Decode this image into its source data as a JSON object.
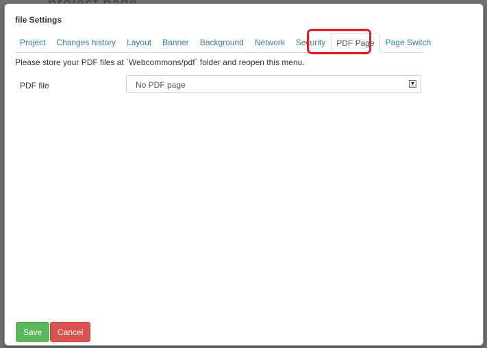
{
  "backdrop": {
    "partial_text": "project page"
  },
  "dialog": {
    "title": "file Settings"
  },
  "tabs": [
    {
      "label": "Project",
      "active": false
    },
    {
      "label": "Changes history",
      "active": false
    },
    {
      "label": "Layout",
      "active": false
    },
    {
      "label": "Banner",
      "active": false
    },
    {
      "label": "Background",
      "active": false
    },
    {
      "label": "Network",
      "active": false
    },
    {
      "label": "Security",
      "active": false
    },
    {
      "label": "PDF Page",
      "active": true
    },
    {
      "label": "Page Switch",
      "active": false
    }
  ],
  "pdf_page": {
    "notice": "Please store your PDF files at `Webcommons/pdf` folder and reopen this menu.",
    "field_label": "PDF file",
    "select_value": "No PDF page"
  },
  "footer": {
    "save_label": "Save",
    "cancel_label": "Cancel"
  },
  "colors": {
    "link": "#337ab7",
    "save": "#5cb85c",
    "cancel": "#d9534f",
    "highlight": "#e02020"
  },
  "icons": {
    "select_arrow": "chevron-down-icon"
  }
}
